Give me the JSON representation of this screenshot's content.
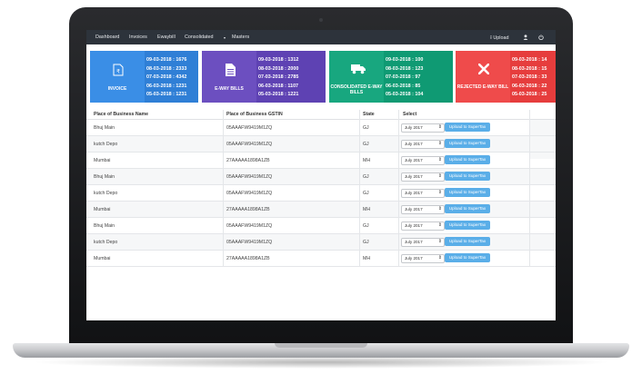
{
  "nav": {
    "items": [
      "Dashboard",
      "Invoices",
      "Ewaybill",
      "Consolidated",
      "Masters"
    ],
    "upload_label": "Upload"
  },
  "cards": [
    {
      "label": "INVOICE",
      "color": "#3a8ee6",
      "icon": "invoice-icon",
      "lines": [
        "09-03-2018 : 1676",
        "08-03-2018 : 2333",
        "07-03-2018 : 4342",
        "06-03-2018 : 1231",
        "05-03-2018 : 1231"
      ]
    },
    {
      "label": "E-WAY BILLS",
      "color": "#6c4fc0",
      "icon": "document-icon",
      "lines": [
        "09-03-2018 : 1312",
        "08-03-2018 : 2000",
        "07-03-2018 : 2785",
        "06-03-2018 : 1107",
        "05-03-2018 : 1221"
      ]
    },
    {
      "label": "CONSOLIDATED E-WAY BILLS",
      "color": "#18a77f",
      "icon": "truck-icon",
      "lines": [
        "09-03-2018 : 100",
        "08-03-2018 : 123",
        "07-03-2018 : 97",
        "06-03-2018 : 85",
        "05-03-2018 : 104"
      ]
    },
    {
      "label": "REJECTED E-WAY BILL",
      "color": "#ef4b4b",
      "icon": "close-icon",
      "lines": [
        "09-03-2018 : 14",
        "08-03-2018 : 15",
        "07-03-2018 : 33",
        "06-03-2018 : 22",
        "05-03-2018 : 25"
      ]
    }
  ],
  "table": {
    "headers": [
      "Place of Business Name",
      "Place of Business GSTIN",
      "State",
      "Select"
    ],
    "rows": [
      {
        "name": "Bhuj Main",
        "gstin": "05AAAFW9419M1ZQ",
        "state": "GJ",
        "month": "July 2017",
        "action": "Upload to SuperTax"
      },
      {
        "name": "kutch Depo",
        "gstin": "05AAAFW9419M1ZQ",
        "state": "GJ",
        "month": "July 2017",
        "action": "Upload to SuperTax"
      },
      {
        "name": "Mumbai",
        "gstin": "27AAAAA1898A1ZB",
        "state": "MH",
        "month": "July 2017",
        "action": "Upload to SuperTax"
      },
      {
        "name": "Bhuj Main",
        "gstin": "05AAAFW9419M1ZQ",
        "state": "GJ",
        "month": "July 2017",
        "action": "Upload to SuperTax"
      },
      {
        "name": "kutch Depo",
        "gstin": "05AAAFW9419M1ZQ",
        "state": "GJ",
        "month": "July 2017",
        "action": "Upload to SuperTax"
      },
      {
        "name": "Mumbai",
        "gstin": "27AAAAA1898A1ZB",
        "state": "MH",
        "month": "July 2017",
        "action": "Upload to SuperTax"
      },
      {
        "name": "Bhuj Main",
        "gstin": "05AAAFW9419M1ZQ",
        "state": "GJ",
        "month": "July 2017",
        "action": "Upload to SuperTax"
      },
      {
        "name": "kutch Depo",
        "gstin": "05AAAFW9419M1ZQ",
        "state": "GJ",
        "month": "July 2017",
        "action": "Upload to SuperTax"
      },
      {
        "name": "Mumbai",
        "gstin": "27AAAAA1898A1ZB",
        "state": "MH",
        "month": "July 2017",
        "action": "Upload to SuperTax"
      }
    ]
  }
}
